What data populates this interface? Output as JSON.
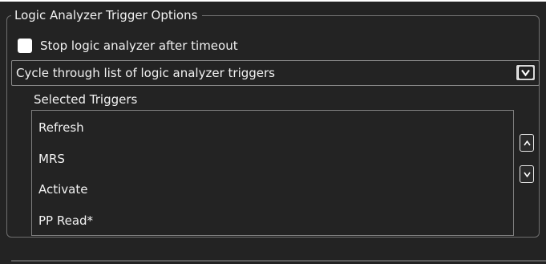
{
  "group": {
    "title": "Logic Analyzer Trigger Options"
  },
  "checkbox": {
    "label": "Stop logic analyzer after timeout",
    "checked": false
  },
  "dropdown": {
    "selected": "Cycle through list of logic analyzer triggers",
    "icon": "chevron-down-icon"
  },
  "selected_triggers": {
    "label": "Selected Triggers",
    "items": [
      "Refresh",
      "MRS",
      "Activate",
      "PP Read*"
    ]
  },
  "reorder": {
    "up_icon": "chevron-up-icon",
    "down_icon": "chevron-down-icon"
  },
  "colors": {
    "background": "#232323",
    "text": "#f2f2f2",
    "border": "#6f6f6f"
  }
}
